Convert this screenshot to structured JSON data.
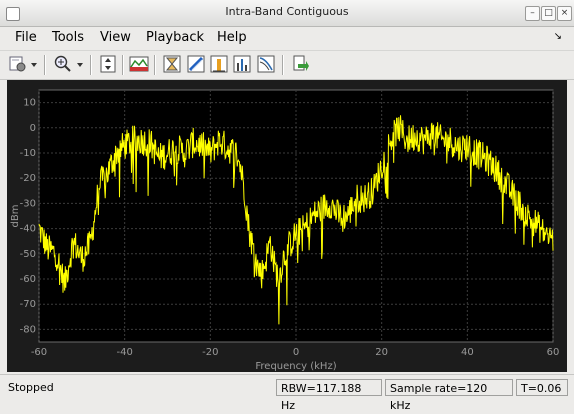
{
  "window": {
    "title": "Intra-Band Contiguous"
  },
  "menu": {
    "file": "File",
    "tools": "Tools",
    "view": "View",
    "playback": "Playback",
    "help": "Help"
  },
  "colors": {
    "plot_background": "#000000",
    "trace": "#ffff00",
    "axis_text": "#9a9a9a",
    "grid": "#3c3c3c"
  },
  "toolbar": {
    "icons": [
      "configuration-icon",
      "dropdown-arrow-icon",
      "zoom-in-icon",
      "dropdown-arrow-icon",
      "scale-axes-icon",
      "spectrum-settings-icon",
      "cursor-measurements-icon",
      "channel-measurements-icon",
      "peak-finder-icon",
      "distortion-measurements-icon",
      "ccdf-measurements-icon",
      "print-to-figure-icon"
    ]
  },
  "chart_data": {
    "type": "line",
    "xlabel": "Frequency (kHz)",
    "ylabel": "dBm",
    "xlim": [
      -60,
      60
    ],
    "ylim": [
      -85,
      15
    ],
    "xticks": [
      -60,
      -40,
      -20,
      0,
      20,
      40,
      60
    ],
    "yticks": [
      10,
      0,
      -10,
      -20,
      -30,
      -40,
      -50,
      -60,
      -70,
      -80
    ],
    "grid": true,
    "series": [
      {
        "color": "#ffff00",
        "x": [
          -60,
          -58,
          -56,
          -54,
          -52,
          -50,
          -48,
          -47,
          -46,
          -45,
          -44,
          -42,
          -40,
          -38,
          -36,
          -34,
          -32,
          -30,
          -28,
          -26,
          -24,
          -22,
          -20,
          -18,
          -16,
          -14,
          -13,
          -12,
          -11,
          -10,
          -9,
          -8,
          -7,
          -6,
          -5,
          -4,
          -3,
          -2,
          -1,
          0,
          2,
          4,
          6,
          8,
          10,
          12,
          14,
          16,
          18,
          19,
          20,
          22,
          24,
          26,
          28,
          30,
          32,
          34,
          36,
          38,
          40,
          42,
          44,
          46,
          48,
          50,
          52,
          54,
          56,
          58,
          60
        ],
        "values": [
          -40,
          -48,
          -50,
          -62,
          -45,
          -52,
          -46,
          -35,
          -23,
          -20,
          -18,
          -10,
          -7,
          -5,
          -5,
          -6,
          -12,
          -10,
          -8,
          -10,
          -6,
          -7,
          -10,
          -5,
          -8,
          -10,
          -15,
          -25,
          -40,
          -48,
          -55,
          -58,
          -52,
          -45,
          -55,
          -60,
          -52,
          -48,
          -45,
          -42,
          -40,
          -35,
          -32,
          -30,
          -35,
          -35,
          -28,
          -28,
          -25,
          -20,
          -15,
          -5,
          0,
          -5,
          -3,
          -5,
          -2,
          -5,
          -5,
          -8,
          -7,
          -10,
          -12,
          -15,
          -20,
          -25,
          -30,
          -35,
          -38,
          -42,
          -44
        ]
      }
    ]
  },
  "status": {
    "state": "Stopped",
    "rbw": "RBW=117.188 Hz",
    "sample_rate": "Sample rate=120 kHz",
    "time": "T=0.06"
  }
}
